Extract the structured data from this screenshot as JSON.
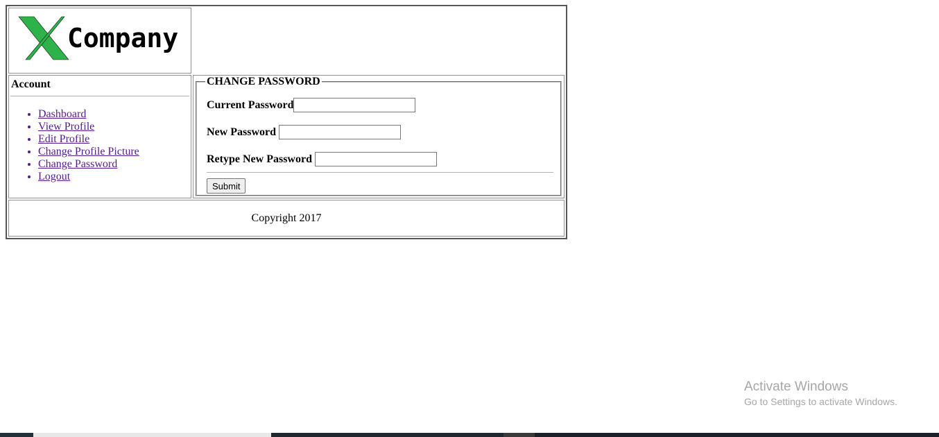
{
  "header": {
    "logo_text": "Company",
    "logo_letter": "X",
    "logo_color": "#2db34a"
  },
  "sidebar": {
    "title": "Account",
    "items": [
      {
        "label": "Dashboard"
      },
      {
        "label": "View Profile"
      },
      {
        "label": "Edit Profile"
      },
      {
        "label": "Change Profile Picture"
      },
      {
        "label": "Change Password"
      },
      {
        "label": "Logout"
      }
    ],
    "link_color": "#551a8b"
  },
  "form": {
    "legend": "CHANGE PASSWORD",
    "current_password_label": "Current Password",
    "current_password_value": "",
    "new_password_label": "New Password",
    "new_password_value": "",
    "retype_password_label": "Retype New Password",
    "retype_password_value": "",
    "submit_label": "Submit"
  },
  "footer": {
    "copyright": "Copyright 2017"
  },
  "watermark": {
    "title": "Activate Windows",
    "subtitle": "Go to Settings to activate Windows."
  }
}
